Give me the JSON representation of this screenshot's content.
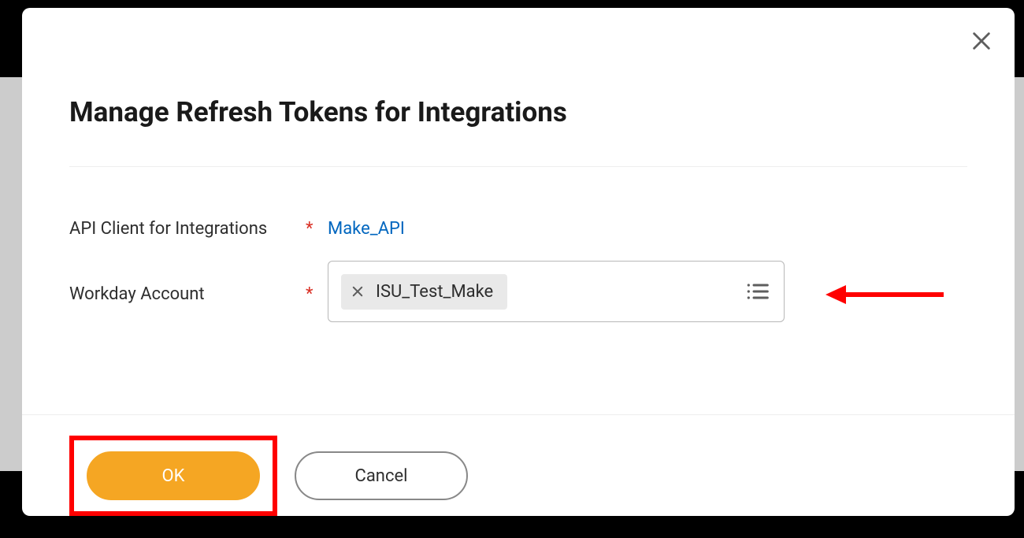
{
  "dialog": {
    "title": "Manage Refresh Tokens for Integrations",
    "close_aria": "Close",
    "fields": {
      "api_client": {
        "label": "API Client for Integrations",
        "required": "*",
        "value": "Make_API"
      },
      "workday_account": {
        "label": "Workday Account",
        "required": "*",
        "chip_value": "ISU_Test_Make"
      }
    },
    "buttons": {
      "ok": "OK",
      "cancel": "Cancel"
    }
  },
  "annotations": {
    "arrow_color": "#ff0000",
    "highlight_color": "#ff0000"
  }
}
